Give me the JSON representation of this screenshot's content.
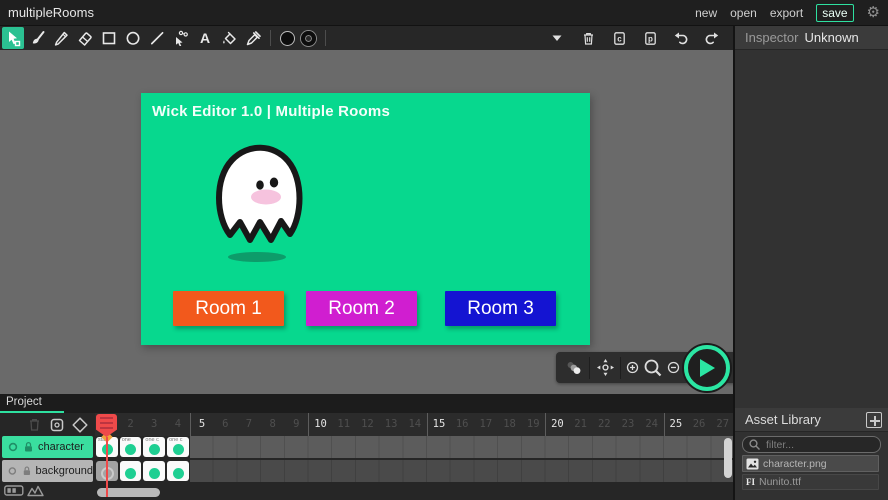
{
  "accent": "#2ee0a0",
  "topbar": {
    "title": "multipleRooms",
    "actions": [
      {
        "label": "new"
      },
      {
        "label": "open"
      },
      {
        "label": "export"
      },
      {
        "label": "save",
        "highlighted": true
      }
    ],
    "gear_glyph": "⚙"
  },
  "toolbar": {
    "tools": [
      "cursor",
      "brush",
      "pencil",
      "eraser",
      "rectangle",
      "ellipse",
      "line",
      "path-cursor",
      "text",
      "fill-bucket",
      "eyedropper"
    ],
    "selected_tool": "cursor",
    "fill_color": "#000000",
    "stroke_color": "#000000",
    "edit_actions": [
      "more",
      "delete",
      "copy",
      "paste",
      "undo",
      "redo"
    ]
  },
  "inspector": {
    "header": "Inspector",
    "selection": "Unknown"
  },
  "stage": {
    "title": "Wick Editor 1.0 | Multiple Rooms",
    "background_color": "#07d88e",
    "ghost": {
      "body": "#ffffff",
      "outline": "#181818",
      "blush": "#f6c3de",
      "shadow": "#0d9c6a"
    },
    "buttons": [
      {
        "label": "Room 1",
        "color": "#f2591c"
      },
      {
        "label": "Room 2",
        "color": "#d01ed0"
      },
      {
        "label": "Room 3",
        "color": "#1414d2"
      }
    ]
  },
  "canvas_controls": {
    "icons": [
      "onion-skin",
      "pan",
      "zoom-in",
      "magnifier",
      "zoom-out",
      "recenter"
    ],
    "play_color": "#2be6a3"
  },
  "timeline": {
    "tab": "Project",
    "frame_count": 27,
    "bold_every": 5,
    "playhead_frame": 1,
    "header_icons": [
      "delete-frame",
      "onion-skin-box",
      "add-keyframe"
    ],
    "layers": [
      {
        "name": "character",
        "selected": true,
        "frames": [
          {
            "n": 1,
            "label": "start",
            "dot": "filled"
          },
          {
            "n": 2,
            "label": "one",
            "dot": "filled"
          },
          {
            "n": 3,
            "label": "one c",
            "dot": "filled"
          },
          {
            "n": 4,
            "label": "one c",
            "dot": "filled"
          }
        ]
      },
      {
        "name": "background",
        "selected": false,
        "frames": [
          {
            "n": 1,
            "label": "",
            "dot": "hollow"
          },
          {
            "n": 2,
            "label": "",
            "dot": "filled"
          },
          {
            "n": 3,
            "label": "",
            "dot": "filled"
          },
          {
            "n": 4,
            "label": "",
            "dot": "filled"
          }
        ]
      }
    ]
  },
  "asset_library": {
    "title": "Asset Library",
    "filter_placeholder": "filter...",
    "assets": [
      {
        "name": "character.png",
        "type": "image"
      },
      {
        "name": "Nunito.ttf",
        "type": "font",
        "icon_text": "FI"
      }
    ]
  }
}
